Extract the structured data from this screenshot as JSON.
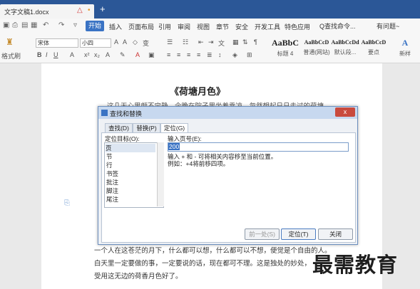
{
  "window": {
    "tab_title": "文字文稿1.docx",
    "tab_warn_icon": "△",
    "tab_dot": "•",
    "new_tab": "+"
  },
  "menubar": {
    "start": "开始",
    "items": [
      "插入",
      "页面布局",
      "引用",
      "审阅",
      "视图",
      "章节",
      "安全",
      "开发工具",
      "特色应用"
    ],
    "search": "Q查找命令...",
    "help": "有问题~"
  },
  "ribbon": {
    "format_painter": "格式刷",
    "font_name": "宋体",
    "font_size": "小四",
    "styles": [
      {
        "sample": "AaBbC",
        "name": "标题 4"
      },
      {
        "sample": "AaBbCcD",
        "name": "普通(网站)"
      },
      {
        "sample": "AaBbCcDd",
        "name": "默认段..."
      },
      {
        "sample": "AaBbCcD",
        "name": "要点"
      },
      {
        "sample": "A",
        "name": "新样"
      }
    ]
  },
  "document": {
    "title": "《荷塘月色》",
    "line1": "这几天心里颇不宁静。今晚在院子里坐着乘凉，忽然想起日日走过的荷塘",
    "line2": "一个人在这苍茫的月下，什么都可以想，什么都可以不想，便觉是个自由的人。",
    "line3": "白天里一定要做的事，一定要说的话，现在都可不理。这是独处的妙处，",
    "line4": "受用这无边的荷香月色好了。"
  },
  "dialog": {
    "title": "查找和替换",
    "close": "x",
    "tabs": [
      "查找(D)",
      "替换(P)",
      "定位(G)"
    ],
    "target_label": "定位目标(O):",
    "targets": [
      "页",
      "节",
      "行",
      "书签",
      "批注",
      "脚注",
      "尾注"
    ],
    "input_label": "输入页号(E):",
    "input_value": "200",
    "hint1": "输入 + 和 - 可将相关内容移至当前位置。",
    "hint2": "例如：+4将前移四项。",
    "prev_button": "前一处(S)",
    "goto_button": "定位(T)",
    "close_button": "关闭"
  },
  "watermark": "最需教育"
}
